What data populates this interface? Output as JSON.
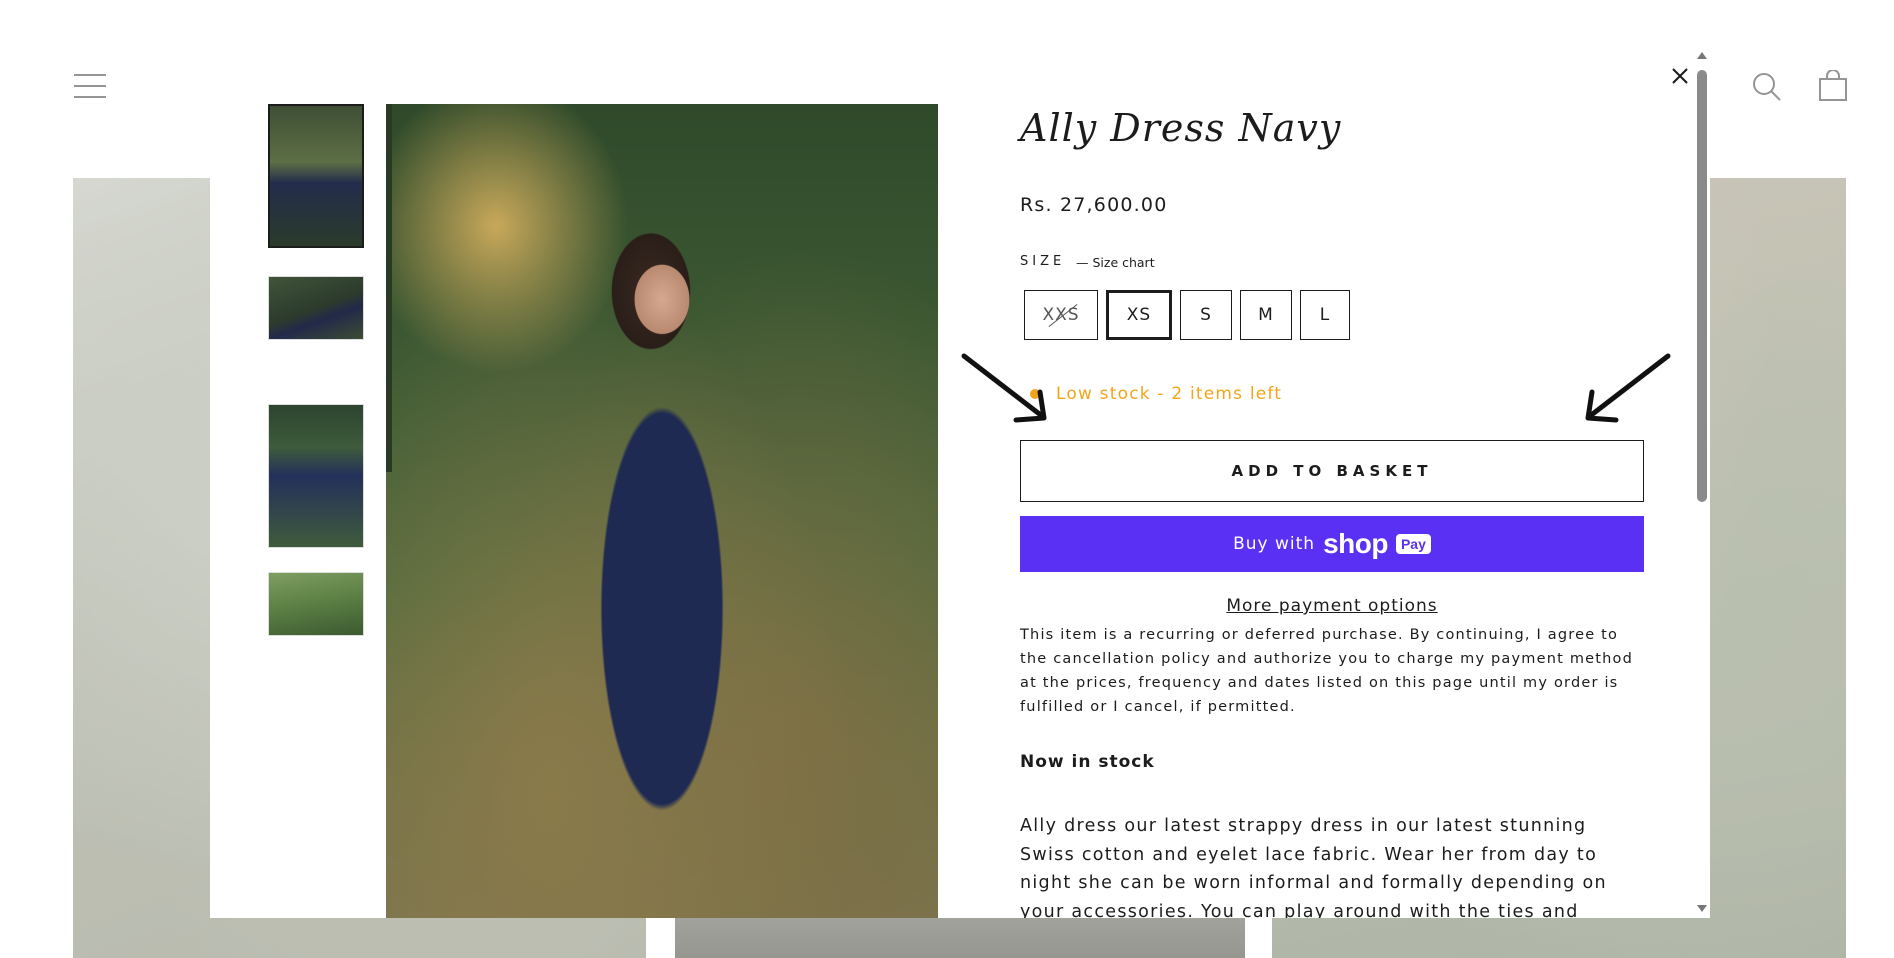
{
  "background": {
    "icons": [
      "hamburger-menu-icon",
      "search-icon",
      "cart-icon"
    ]
  },
  "modal": {
    "close_icon": "close-icon",
    "thumbnails": [
      {
        "alt": "thumb-1",
        "active": true
      },
      {
        "alt": "thumb-2",
        "active": false
      },
      {
        "alt": "thumb-3",
        "active": false
      },
      {
        "alt": "thumb-4",
        "active": false
      }
    ],
    "product": {
      "title": "Ally Dress Navy",
      "price": "Rs. 27,600.00",
      "size_label": "SIZE",
      "size_chart": "— Size chart",
      "sizes": [
        {
          "label": "XXS",
          "state": "sold-out"
        },
        {
          "label": "XS",
          "state": "selected"
        },
        {
          "label": "S",
          "state": "available"
        },
        {
          "label": "M",
          "state": "available"
        },
        {
          "label": "L",
          "state": "available"
        }
      ],
      "stock_text": "Low stock - 2 items left",
      "stock_color": "#f2a51a",
      "add_to_basket": "ADD TO BASKET",
      "shop_pay": {
        "buy_with": "Buy with",
        "logo": "shop",
        "badge": "Pay",
        "color": "#5a31f4"
      },
      "more_payment": "More payment options",
      "disclaimer": "This item is a recurring or deferred purchase. By continuing, I agree to the cancellation policy and authorize you to charge my payment method at the prices, frequency and dates listed on this page until my order is fulfilled or I cancel, if permitted.",
      "stock_heading": "Now in stock",
      "description": "Ally dress our latest strappy dress in our latest stunning Swiss cotton and eyelet lace fabric. Wear her from day to night she can be worn informal and formally depending on your accessories. You can play around with the ties and either have the crossed over at the back or"
    }
  }
}
